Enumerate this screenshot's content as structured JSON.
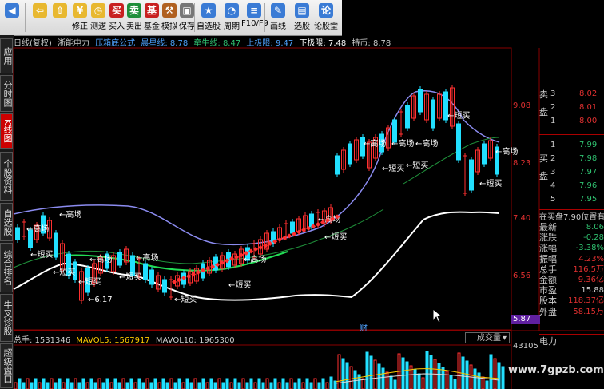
{
  "toolbar": {
    "buttons": [
      {
        "label": "",
        "icon": "speaker-icon",
        "color": "#3a7bd5"
      },
      {
        "label": "",
        "icon": "back-arrow-icon",
        "color": "#e8b830"
      },
      {
        "label": "",
        "icon": "up-arrow-icon",
        "color": "#e8b830"
      },
      {
        "label": "修正",
        "icon": "coin-icon",
        "color": "#e8b830"
      },
      {
        "label": "测逻",
        "icon": "clock-icon",
        "color": "#e8b830"
      },
      {
        "label": "买入",
        "icon": "buy-icon",
        "color": "#c82020"
      },
      {
        "label": "卖出",
        "icon": "sell-icon",
        "color": "#1f8f3a"
      },
      {
        "label": "基金",
        "icon": "fund-icon",
        "color": "#c82020"
      },
      {
        "label": "模拟",
        "icon": "hammer-icon",
        "color": "#b06020"
      },
      {
        "label": "保存",
        "icon": "lock-icon",
        "color": "#777777"
      },
      {
        "label": "自选股",
        "icon": "stock-list-icon",
        "color": "#3a7bd5"
      },
      {
        "label": "周期",
        "icon": "period-icon",
        "color": "#3a7bd5"
      },
      {
        "label": "F10/F9",
        "icon": "f10-icon",
        "color": "#3a7bd5"
      },
      {
        "label": "画线",
        "icon": "pen-icon",
        "color": "#3a7bd5"
      },
      {
        "label": "选股",
        "icon": "select-stock-icon",
        "color": "#3a7bd5"
      },
      {
        "label": "论股堂",
        "icon": "forum-icon",
        "color": "#3a7bd5"
      }
    ]
  },
  "sidebar": {
    "tabs": [
      {
        "label": "应用",
        "active": false
      },
      {
        "label": "分时图",
        "active": false
      },
      {
        "label": "K线图",
        "active": true
      },
      {
        "label": "个股资料",
        "active": false
      },
      {
        "label": "自选股",
        "active": false
      },
      {
        "label": "综合排名",
        "active": false
      },
      {
        "label": "牛叉诊股",
        "active": false
      },
      {
        "label": "超级盘口",
        "active": false
      }
    ]
  },
  "info_line": {
    "items": [
      {
        "text": "日线(复权)",
        "color": "#cccccc"
      },
      {
        "text": "浙能电力",
        "color": "#cccccc"
      },
      {
        "text": "压箱底公式",
        "color": "#4fa3ff"
      },
      {
        "text": "晨星线: 8.78",
        "color": "#4fa3ff"
      },
      {
        "text": "牵牛线: 8.47",
        "color": "#2fbf6f"
      },
      {
        "text": "上极限: 9.47",
        "color": "#4fa3ff"
      },
      {
        "text": "下极限: 7.48",
        "color": "#ffffff"
      },
      {
        "text": "持币: 8.78",
        "color": "#cccccc"
      }
    ]
  },
  "price_axis": {
    "labels": [
      "9.08",
      "8.23",
      "7.40",
      "6.56"
    ],
    "last_price_box": "5.87",
    "volume_label": "43105"
  },
  "chart_annotations": {
    "sell_labels": [
      "高场",
      "高场",
      "高场",
      "高场",
      "高场",
      "高场",
      "高场",
      "高场",
      "高场",
      "高场"
    ],
    "buy_labels": [
      "短买",
      "短买",
      "短买",
      "短买",
      "短买",
      "短买",
      "短买",
      "短买",
      "短买",
      "短买",
      "短买"
    ],
    "low_price": "6.17",
    "cai_marker": "财"
  },
  "volume_line": {
    "items": [
      {
        "text": "总手: 1531346",
        "color": "#cccccc"
      },
      {
        "text": "MAVOL5: 1567917",
        "color": "#ffcc00"
      },
      {
        "text": "MAVOL10: 1965300",
        "color": "#cccccc"
      }
    ],
    "indicator_select": "成交量"
  },
  "right_panel": {
    "sell_header": "卖盘",
    "buy_header": "买盘",
    "sell_levels": [
      {
        "level": "3",
        "price": "8.02"
      },
      {
        "level": "2",
        "price": "8.01"
      },
      {
        "level": "1",
        "price": "8.00"
      }
    ],
    "buy_levels": [
      {
        "level": "1",
        "price": "7.99"
      },
      {
        "level": "2",
        "price": "7.98"
      },
      {
        "level": "3",
        "price": "7.97"
      },
      {
        "level": "4",
        "price": "7.96"
      },
      {
        "level": "5",
        "price": "7.95"
      }
    ],
    "position_note": "在买盘7.90位置有",
    "stats": [
      {
        "label": "最新",
        "value": "8.06"
      },
      {
        "label": "涨跌",
        "value": "-0.28"
      },
      {
        "label": "涨幅",
        "value": "-3.38%"
      },
      {
        "label": "振幅",
        "value": "4.23%"
      },
      {
        "label": "总手",
        "value": "116.5万"
      },
      {
        "label": "金额",
        "value": "9.36亿"
      },
      {
        "label": "市盈",
        "value": "15.88"
      },
      {
        "label": "股本",
        "value": "118.37亿"
      },
      {
        "label": "外盘",
        "value": "58.15万"
      }
    ],
    "footer_label": "电力"
  },
  "watermark": "www.7gpzb.com"
}
